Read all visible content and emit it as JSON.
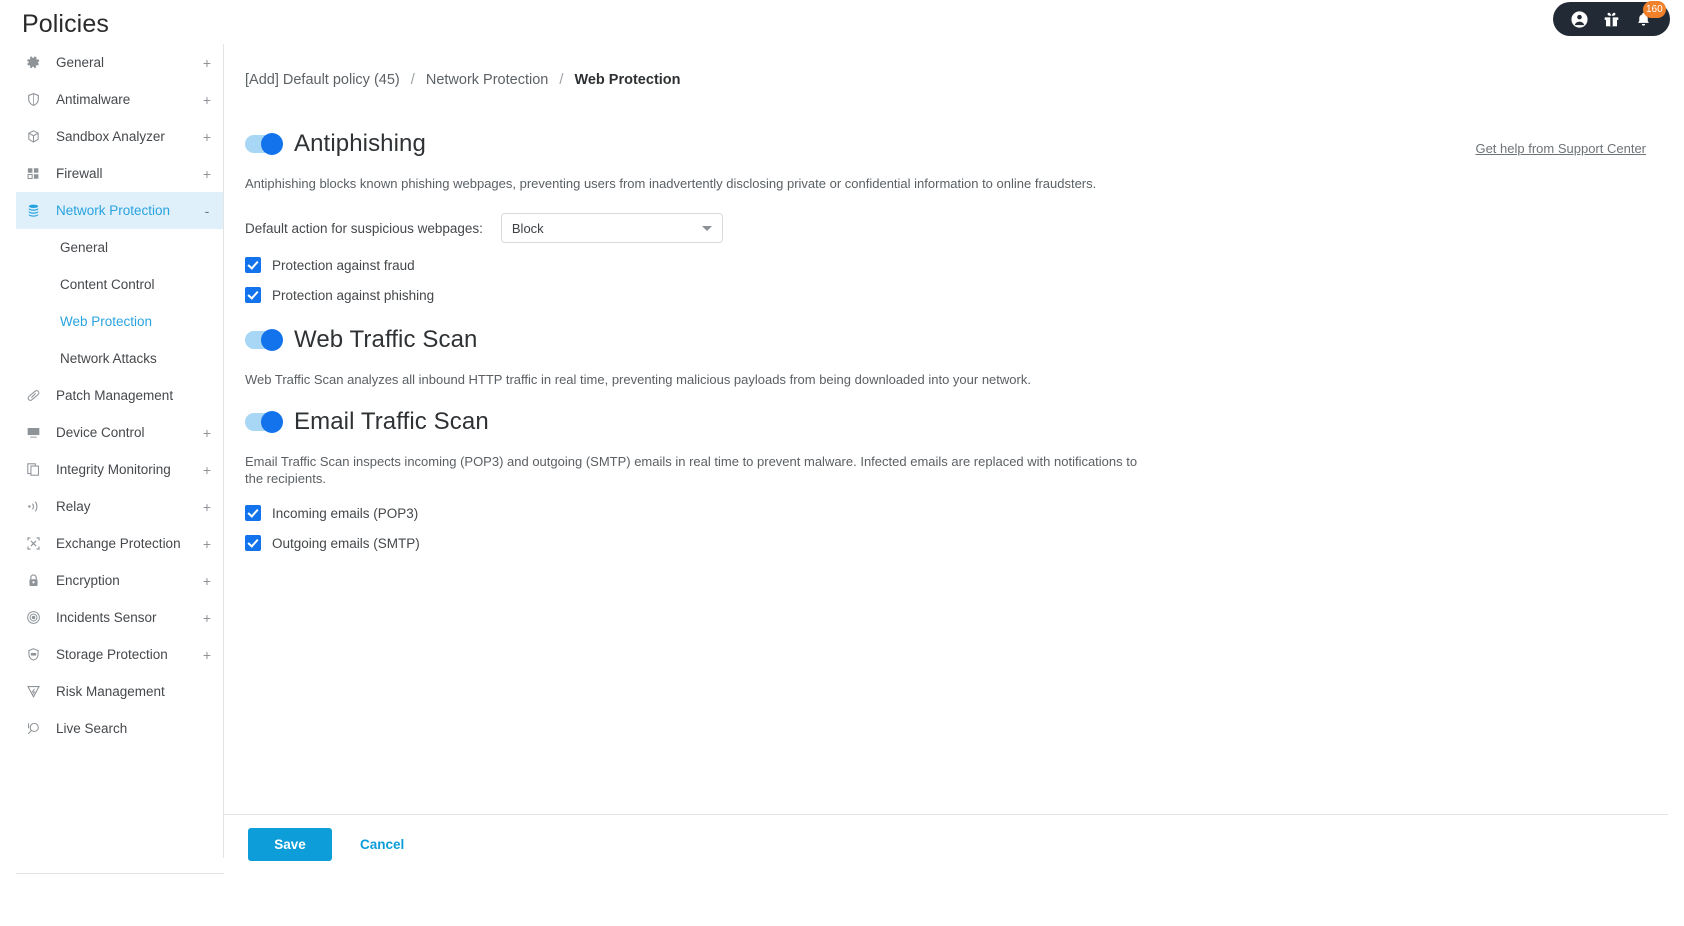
{
  "header": {
    "title": "Policies",
    "topbar_icons": [
      {
        "name": "account-icon",
        "glyph": "user"
      },
      {
        "name": "gift-icon",
        "glyph": "gift"
      },
      {
        "name": "notifications-icon",
        "glyph": "bell",
        "badge": "160"
      }
    ]
  },
  "sidebar": {
    "items": [
      {
        "label": "General",
        "icon": "gear-icon",
        "expander": "+",
        "active": false
      },
      {
        "label": "Antimalware",
        "icon": "shield-icon",
        "expander": "+",
        "active": false
      },
      {
        "label": "Sandbox Analyzer",
        "icon": "cube-icon",
        "expander": "+",
        "active": false
      },
      {
        "label": "Firewall",
        "icon": "firewall-icon",
        "expander": "+",
        "active": false
      },
      {
        "label": "Network Protection",
        "icon": "layers-icon",
        "expander": "-",
        "active": true
      },
      {
        "label": "Patch Management",
        "icon": "bandage-icon",
        "expander": "",
        "active": false
      },
      {
        "label": "Device Control",
        "icon": "monitor-icon",
        "expander": "+",
        "active": false
      },
      {
        "label": "Integrity Monitoring",
        "icon": "copy-icon",
        "expander": "+",
        "active": false
      },
      {
        "label": "Relay",
        "icon": "broadcast-icon",
        "expander": "+",
        "active": false
      },
      {
        "label": "Exchange Protection",
        "icon": "exchange-icon",
        "expander": "+",
        "active": false
      },
      {
        "label": "Encryption",
        "icon": "lock-icon",
        "expander": "+",
        "active": false
      },
      {
        "label": "Incidents Sensor",
        "icon": "target-icon",
        "expander": "+",
        "active": false
      },
      {
        "label": "Storage Protection",
        "icon": "storage-shield-icon",
        "expander": "+",
        "active": false
      },
      {
        "label": "Risk Management",
        "icon": "risk-icon",
        "expander": "",
        "active": false
      },
      {
        "label": "Live Search",
        "icon": "live-search-icon",
        "expander": "",
        "active": false
      }
    ],
    "subitems": [
      {
        "label": "General",
        "active": false
      },
      {
        "label": "Content Control",
        "active": false
      },
      {
        "label": "Web Protection",
        "active": true
      },
      {
        "label": "Network Attacks",
        "active": false
      }
    ]
  },
  "breadcrumb": {
    "policy": "[Add] Default policy (45)",
    "module": "Network Protection",
    "page": "Web Protection",
    "separator": "/"
  },
  "help": {
    "label": "Get help from Support Center"
  },
  "sections": {
    "antiphishing": {
      "title": "Antiphishing",
      "enabled": true,
      "description": "Antiphishing blocks known phishing webpages, preventing users from inadvertently disclosing private or confidential information to online fraudsters.",
      "field_label": "Default action for suspicious webpages:",
      "field_value": "Block",
      "field_options": [
        "Block"
      ],
      "checkboxes": [
        {
          "label": "Protection against fraud",
          "checked": true
        },
        {
          "label": "Protection against phishing",
          "checked": true
        }
      ]
    },
    "web_traffic_scan": {
      "title": "Web Traffic Scan",
      "enabled": true,
      "description": "Web Traffic Scan analyzes all inbound HTTP traffic in real time, preventing malicious payloads from being downloaded into your network."
    },
    "email_traffic_scan": {
      "title": "Email Traffic Scan",
      "enabled": true,
      "description": "Email Traffic Scan inspects incoming (POP3) and outgoing (SMTP) emails in real time to prevent malware. Infected emails are replaced with notifications to the recipients.",
      "checkboxes": [
        {
          "label": "Incoming emails (POP3)",
          "checked": true
        },
        {
          "label": "Outgoing emails (SMTP)",
          "checked": true
        }
      ]
    }
  },
  "footer": {
    "save_label": "Save",
    "cancel_label": "Cancel"
  },
  "colors": {
    "accent_blue": "#0d9dd8",
    "toggle_blue": "#1273ec",
    "active_nav": "#29a3df",
    "badge_orange": "#f08029",
    "topbar_dark": "#222a35"
  }
}
